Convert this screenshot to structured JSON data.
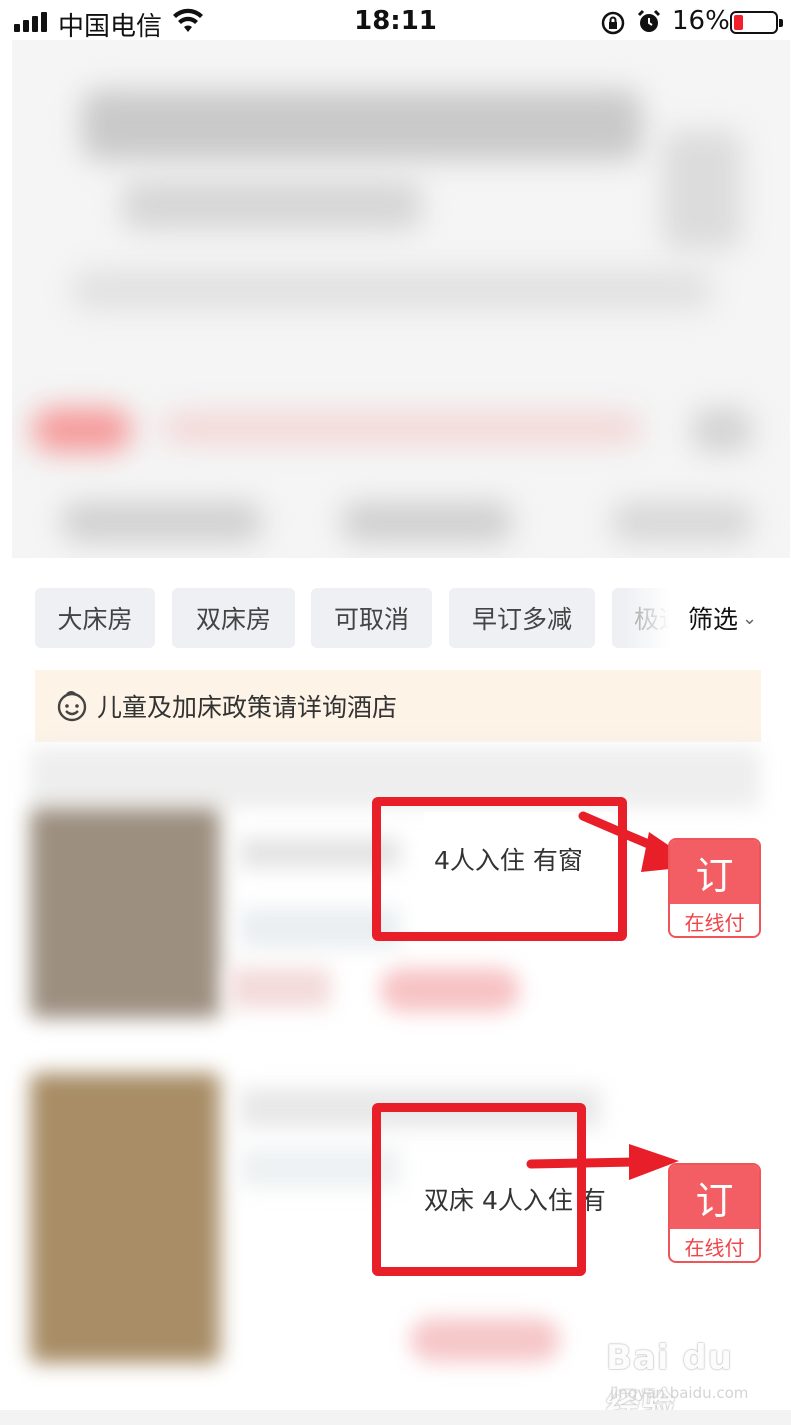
{
  "status_bar": {
    "carrier": "中国电信",
    "time": "18:11",
    "battery_percent": "16%",
    "icons": [
      "signal-icon",
      "wifi-icon",
      "rotation-lock-icon",
      "alarm-icon",
      "battery-icon"
    ]
  },
  "filters": {
    "chips": [
      "大床房",
      "双床房",
      "可取消",
      "早订多减",
      "极速"
    ],
    "filter_button": "筛选"
  },
  "notice": {
    "icon": "child-face-icon",
    "text": "儿童及加床政策请详询酒店"
  },
  "rooms": [
    {
      "info": "4人入住 有窗",
      "book_label": "订",
      "book_sub": "在线付"
    },
    {
      "info": "双床 4人入住 有",
      "book_label": "订",
      "book_sub": "在线付"
    }
  ],
  "colors": {
    "highlight": "#e81e28",
    "book_button": "#f25e63",
    "notice_bg": "#fdf3e6",
    "chip_bg": "#eef0f4"
  },
  "watermark": {
    "main": "Bai du 经验",
    "sub": "jingyan.baidu.com"
  }
}
